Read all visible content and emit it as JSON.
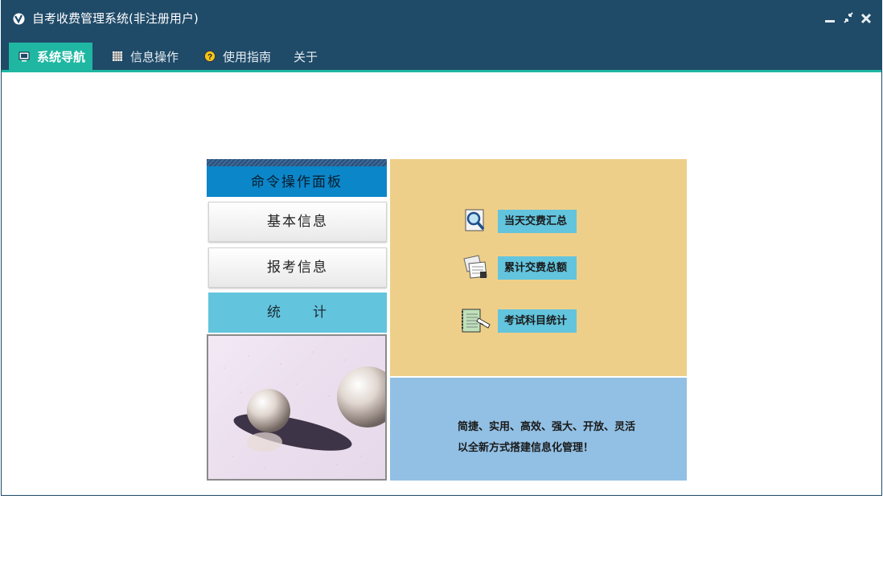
{
  "window": {
    "title": "自考收费管理系统(非注册用户)",
    "controls": [
      "minimize",
      "restore",
      "close"
    ]
  },
  "menu": {
    "items": [
      {
        "label": "系统导航",
        "icon": "monitor-icon",
        "active": true
      },
      {
        "label": "信息操作",
        "icon": "grid-icon",
        "active": false
      },
      {
        "label": "使用指南",
        "icon": "help-icon",
        "active": false
      },
      {
        "label": "关于",
        "icon": "",
        "active": false
      }
    ]
  },
  "panel": {
    "header": "命令操作面板",
    "buttons": {
      "basic_info": "基本信息",
      "exam_info": "报考信息",
      "statistics": "统　　计"
    },
    "actions": {
      "daily_summary": "当天交费汇总",
      "cumulative_total": "累计交费总额",
      "subject_stats": "考试科目统计"
    },
    "slogan": {
      "line1": "简捷、实用、高效、强大、开放、灵活",
      "line2": "以全新方式搭建信息化管理！"
    }
  },
  "colors": {
    "titlebar": "#1f4a68",
    "accent": "#1fb7a2",
    "panel_header": "#0b86c9",
    "action_label": "#63c4dd",
    "panel_top": "#eecf8a",
    "panel_bottom": "#92c0e4"
  }
}
